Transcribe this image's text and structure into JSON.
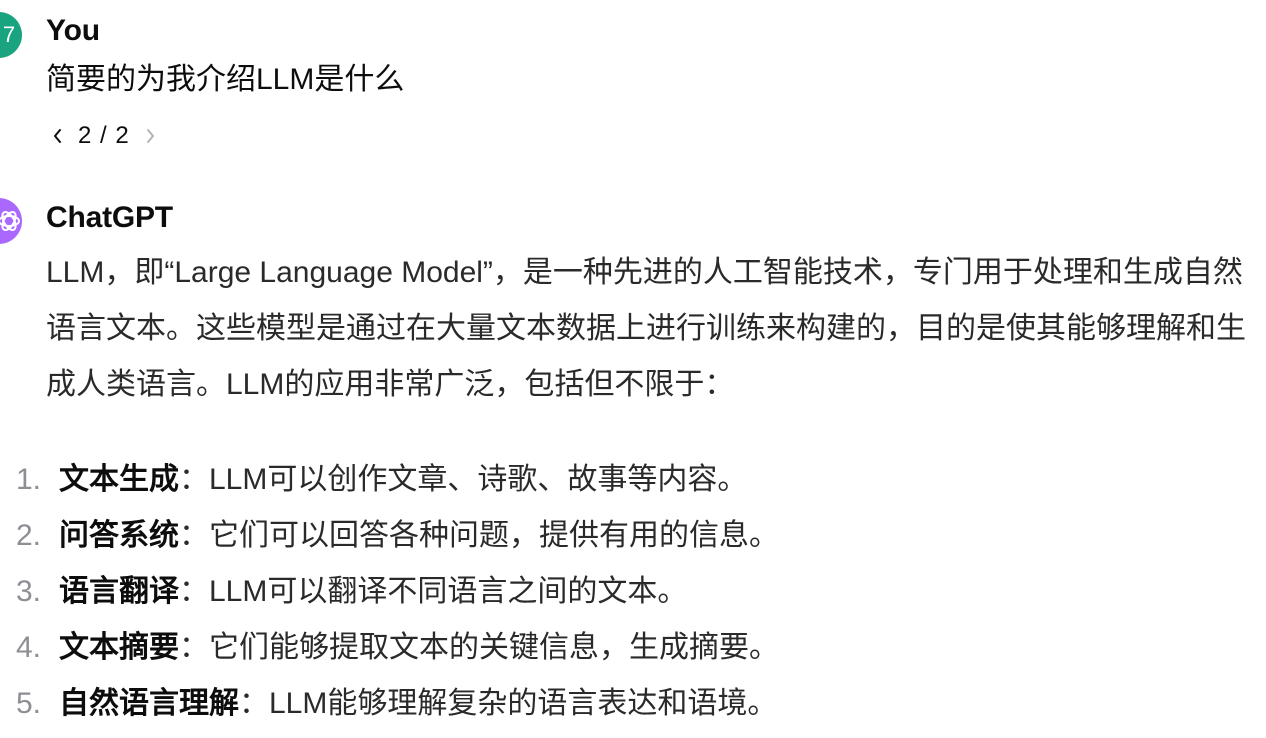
{
  "user": {
    "avatar_initial": "7",
    "name": "You",
    "message": "简要的为我介绍LLM是什么",
    "pager": {
      "prev_icon": "chevron-left-icon",
      "count": "2 / 2",
      "next_icon": "chevron-right-icon"
    }
  },
  "assistant": {
    "name": "ChatGPT",
    "avatar_icon": "openai-logo-icon",
    "intro": "LLM，即“Large Language Model”，是一种先进的人工智能技术，专门用于处理和生成自然语言文本。这些模型是通过在大量文本数据上进行训练来构建的，目的是使其能够理解和生成人类语言。LLM的应用非常广泛，包括但不限于：",
    "items": [
      {
        "num": "1.",
        "term": "文本生成",
        "sep": "：",
        "desc": "LLM可以创作文章、诗歌、故事等内容。"
      },
      {
        "num": "2.",
        "term": "问答系统",
        "sep": "：",
        "desc": "它们可以回答各种问题，提供有用的信息。"
      },
      {
        "num": "3.",
        "term": "语言翻译",
        "sep": "：",
        "desc": "LLM可以翻译不同语言之间的文本。"
      },
      {
        "num": "4.",
        "term": "文本摘要",
        "sep": "：",
        "desc": "它们能够提取文本的关键信息，生成摘要。"
      },
      {
        "num": "5.",
        "term": "自然语言理解",
        "sep": "：",
        "desc": "LLM能够理解复杂的语言表达和语境。"
      }
    ]
  },
  "colors": {
    "user_avatar": "#1aa37f",
    "bot_avatar": "#ab68ff",
    "text": "#0d0d0d",
    "muted": "#8e8e94"
  }
}
